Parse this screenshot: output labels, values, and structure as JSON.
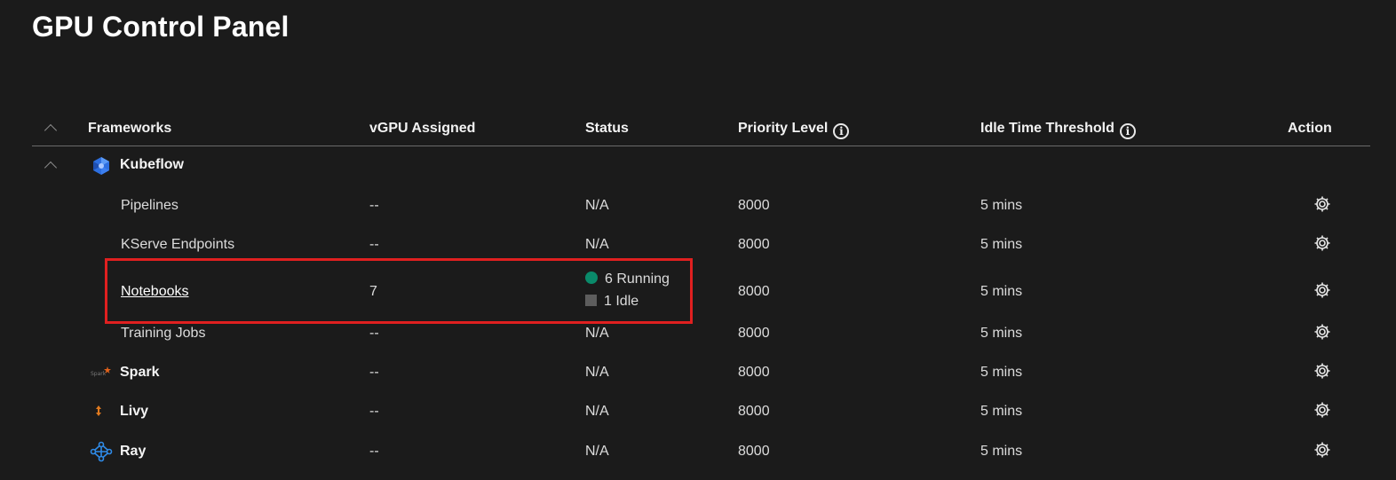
{
  "page": {
    "title": "GPU Control Panel"
  },
  "table": {
    "headers": {
      "frameworks": "Frameworks",
      "vgpu": "vGPU Assigned",
      "status": "Status",
      "priority": "Priority Level",
      "idle": "Idle Time Threshold",
      "action": "Action"
    },
    "groups": [
      {
        "name": "Kubeflow",
        "icon": "kubeflow-logo-icon",
        "expanded": true,
        "children": [
          {
            "name": "Pipelines",
            "vgpu": "--",
            "status": "N/A",
            "priority": "8000",
            "idle": "5 mins"
          },
          {
            "name": "KServe Endpoints",
            "vgpu": "--",
            "status": "N/A",
            "priority": "8000",
            "idle": "5 mins"
          },
          {
            "name": "Notebooks",
            "vgpu": "7",
            "status_running": "6 Running",
            "status_idle": "1 Idle",
            "priority": "8000",
            "idle": "5 mins",
            "link": true
          },
          {
            "name": "Training Jobs",
            "vgpu": "--",
            "status": "N/A",
            "priority": "8000",
            "idle": "5 mins"
          }
        ]
      },
      {
        "name": "Spark",
        "icon": "spark-logo-icon",
        "vgpu": "--",
        "status": "N/A",
        "priority": "8000",
        "idle": "5 mins"
      },
      {
        "name": "Livy",
        "icon": "livy-logo-icon",
        "vgpu": "--",
        "status": "N/A",
        "priority": "8000",
        "idle": "5 mins"
      },
      {
        "name": "Ray",
        "icon": "ray-logo-icon",
        "vgpu": "--",
        "status": "N/A",
        "priority": "8000",
        "idle": "5 mins"
      }
    ]
  },
  "colors": {
    "background": "#1b1b1b",
    "running": "#0a8a6a",
    "idle": "#5d5d5d",
    "highlight": "#e02020"
  }
}
